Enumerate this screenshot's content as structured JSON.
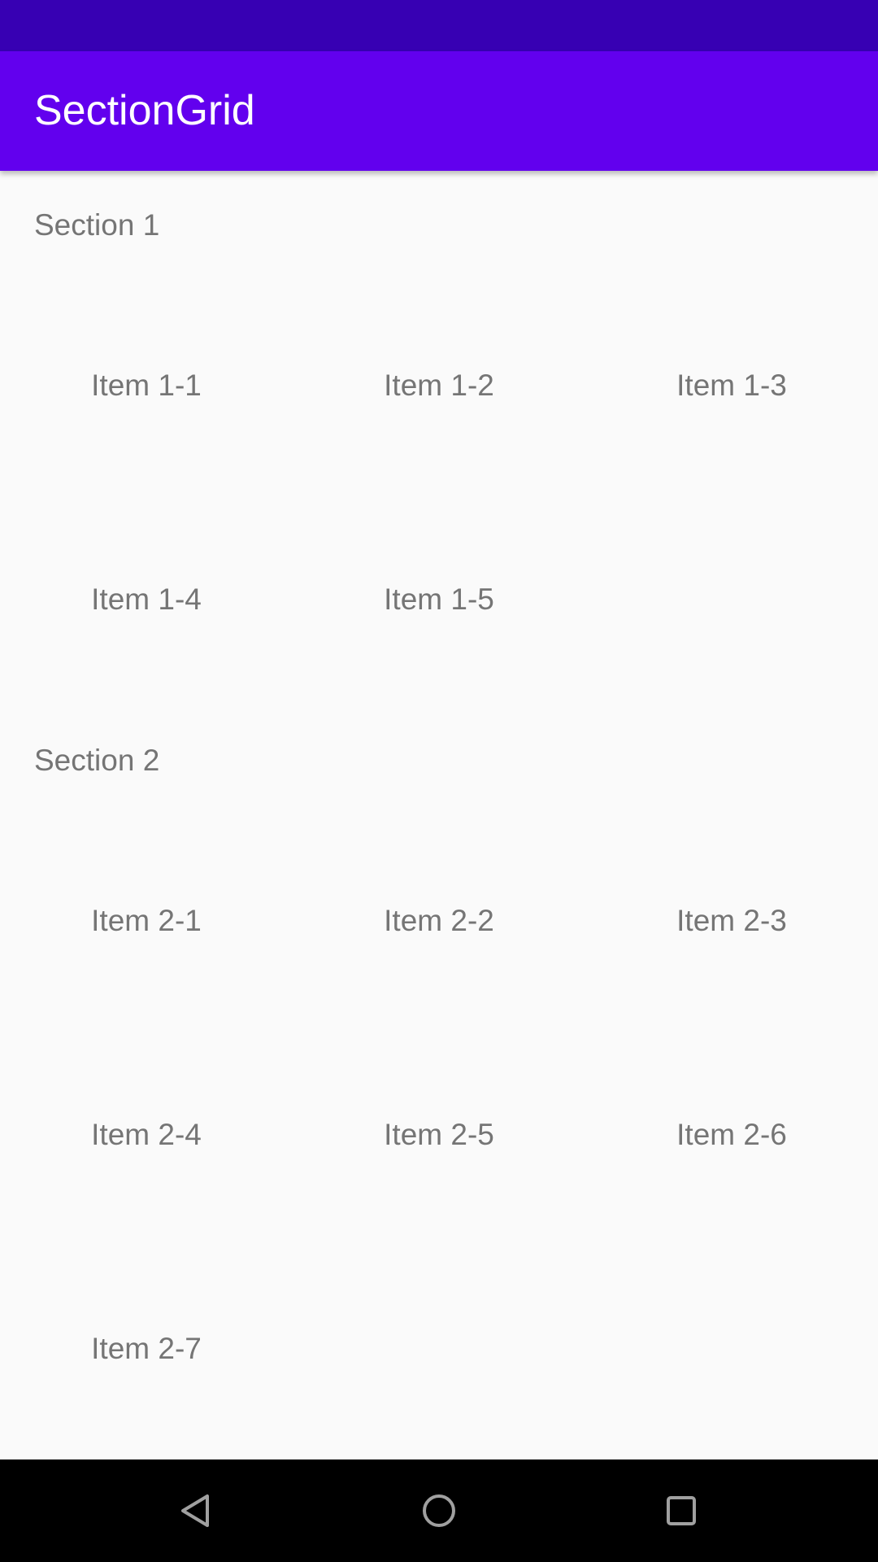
{
  "app_bar": {
    "title": "SectionGrid"
  },
  "sections": [
    {
      "header": "Section 1",
      "items": [
        "Item 1-1",
        "Item 1-2",
        "Item 1-3",
        "Item 1-4",
        "Item 1-5"
      ]
    },
    {
      "header": "Section 2",
      "items": [
        "Item 2-1",
        "Item 2-2",
        "Item 2-3",
        "Item 2-4",
        "Item 2-5",
        "Item 2-6",
        "Item 2-7"
      ]
    }
  ],
  "nav_bar": {
    "icons": [
      "back-icon",
      "home-icon",
      "recents-icon"
    ]
  },
  "colors": {
    "status_bar": "#3700b3",
    "app_bar": "#6200ee",
    "background": "#fafafa",
    "text_secondary": "#757575",
    "nav_bar": "#000000"
  }
}
